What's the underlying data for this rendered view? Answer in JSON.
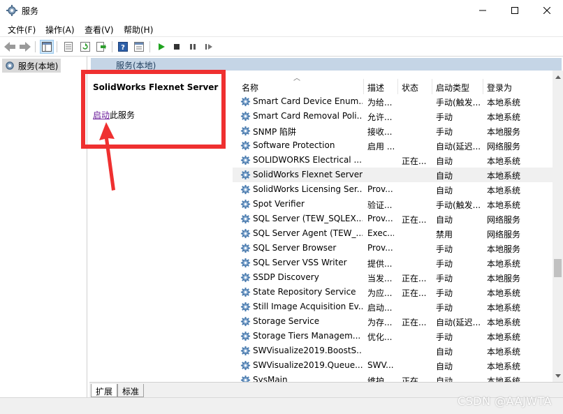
{
  "window": {
    "title": "服务",
    "min_icon": "minimize-icon",
    "max_icon": "maximize-icon",
    "close_icon": "close-icon"
  },
  "menu": [
    "文件(F)",
    "操作(A)",
    "查看(V)",
    "帮助(H)"
  ],
  "toolbar": {
    "icons": [
      "back-icon",
      "forward-icon",
      "console-tree-icon",
      "properties-icon",
      "refresh-icon",
      "export-icon",
      "help-icon",
      "view-icon",
      "start-icon",
      "stop-icon",
      "pause-icon",
      "resume-icon"
    ]
  },
  "tree": {
    "item": "服务(本地)"
  },
  "pane": {
    "header": "服务(本地)"
  },
  "details": {
    "service_name": "SolidWorks Flexnet Server",
    "start_link": "启动",
    "start_suffix": "此服务"
  },
  "columns": [
    "名称",
    "描述",
    "状态",
    "启动类型",
    "登录为"
  ],
  "rows": [
    {
      "name": "Smart Card Device Enum...",
      "desc": "为给...",
      "status": "",
      "startup": "手动(触发...",
      "logon": "本地系统"
    },
    {
      "name": "Smart Card Removal Poli...",
      "desc": "允许...",
      "status": "",
      "startup": "手动",
      "logon": "本地系统"
    },
    {
      "name": "SNMP 陷阱",
      "desc": "接收...",
      "status": "",
      "startup": "手动",
      "logon": "本地服务"
    },
    {
      "name": "Software Protection",
      "desc": "启用 ...",
      "status": "",
      "startup": "自动(延迟...",
      "logon": "网络服务"
    },
    {
      "name": "SOLIDWORKS Electrical ...",
      "desc": "",
      "status": "正在...",
      "startup": "自动",
      "logon": "本地系统"
    },
    {
      "name": "SolidWorks Flexnet Server",
      "desc": "",
      "status": "",
      "startup": "自动",
      "logon": "本地系统",
      "selected": true
    },
    {
      "name": "SolidWorks Licensing Ser...",
      "desc": "Prov...",
      "status": "",
      "startup": "自动",
      "logon": "本地系统"
    },
    {
      "name": "Spot Verifier",
      "desc": "验证...",
      "status": "",
      "startup": "手动(触发...",
      "logon": "本地系统"
    },
    {
      "name": "SQL Server (TEW_SQLEX...",
      "desc": "Prov...",
      "status": "正在...",
      "startup": "自动",
      "logon": "网络服务"
    },
    {
      "name": "SQL Server Agent (TEW_...",
      "desc": "Exec...",
      "status": "",
      "startup": "禁用",
      "logon": "网络服务"
    },
    {
      "name": "SQL Server Browser",
      "desc": "Prov...",
      "status": "",
      "startup": "手动",
      "logon": "本地服务"
    },
    {
      "name": "SQL Server VSS Writer",
      "desc": "提供...",
      "status": "",
      "startup": "手动",
      "logon": "本地系统"
    },
    {
      "name": "SSDP Discovery",
      "desc": "当发...",
      "status": "正在...",
      "startup": "手动",
      "logon": "本地服务"
    },
    {
      "name": "State Repository Service",
      "desc": "为应...",
      "status": "正在...",
      "startup": "手动",
      "logon": "本地系统"
    },
    {
      "name": "Still Image Acquisition Ev...",
      "desc": "启动...",
      "status": "",
      "startup": "手动",
      "logon": "本地系统"
    },
    {
      "name": "Storage Service",
      "desc": "为存...",
      "status": "正在...",
      "startup": "自动(延迟...",
      "logon": "本地系统"
    },
    {
      "name": "Storage Tiers Managem...",
      "desc": "优化...",
      "status": "",
      "startup": "手动",
      "logon": "本地系统"
    },
    {
      "name": "SWVisualize2019.BoostS...",
      "desc": "",
      "status": "",
      "startup": "自动",
      "logon": "本地系统"
    },
    {
      "name": "SWVisualize2019.Queue...",
      "desc": "SWV...",
      "status": "",
      "startup": "自动",
      "logon": "本地系统"
    },
    {
      "name": "SysMain",
      "desc": "维护...",
      "status": "正在...",
      "startup": "自动",
      "logon": "本地系统"
    }
  ],
  "tabs": [
    "扩展",
    "标准"
  ],
  "watermark": "CSDN @AAJWTA",
  "colors": {
    "highlight_red": "#ef3030",
    "pane_header": "#c5d5e6",
    "link": "#6a1b9a",
    "gear_blue": "#4a7fb5"
  }
}
